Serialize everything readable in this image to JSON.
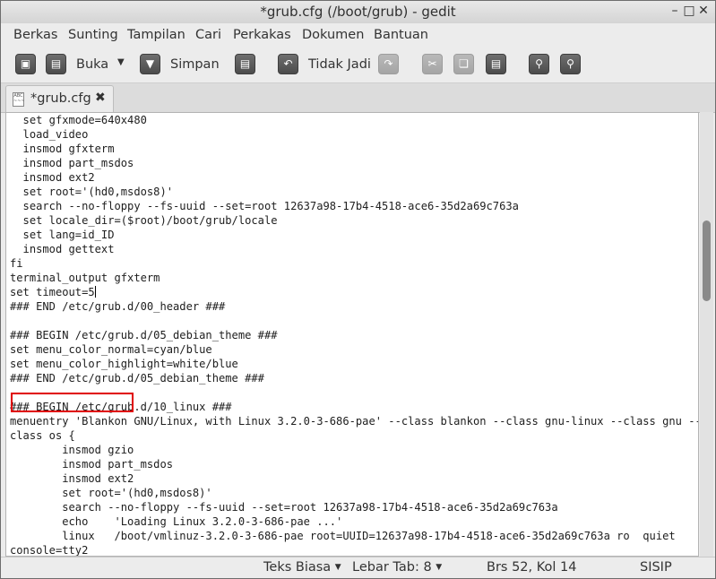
{
  "window": {
    "title": "*grub.cfg (/boot/grub) - gedit",
    "controls": [
      "–",
      "□",
      "✕"
    ]
  },
  "menubar": {
    "items": [
      "Berkas",
      "Sunting",
      "Tampilan",
      "Cari",
      "Perkakas",
      "Dokumen",
      "Bantuan"
    ]
  },
  "toolbar": {
    "open_label": "Buka",
    "save_label": "Simpan",
    "undo_label": "Tidak Jadi"
  },
  "tabs": [
    {
      "label": "*grub.cfg",
      "close": "✖"
    }
  ],
  "editor": {
    "lines": [
      "  set gfxmode=640x480",
      "  load_video",
      "  insmod gfxterm",
      "  insmod part_msdos",
      "  insmod ext2",
      "  set root='(hd0,msdos8)'",
      "  search --no-floppy --fs-uuid --set=root 12637a98-17b4-4518-ace6-35d2a69c763a",
      "  set locale_dir=($root)/boot/grub/locale",
      "  set lang=id_ID",
      "  insmod gettext",
      "fi",
      "terminal_output gfxterm",
      "set timeout=5",
      "### END /etc/grub.d/00_header ###",
      "",
      "### BEGIN /etc/grub.d/05_debian_theme ###",
      "set menu_color_normal=cyan/blue",
      "set menu_color_highlight=white/blue",
      "### END /etc/grub.d/05_debian_theme ###",
      "",
      "### BEGIN /etc/grub.d/10_linux ###",
      "menuentry 'Blankon GNU/Linux, with Linux 3.2.0-3-686-pae' --class blankon --class gnu-linux --class gnu --",
      "class os {",
      "        insmod gzio",
      "        insmod part_msdos",
      "        insmod ext2",
      "        set root='(hd0,msdos8)'",
      "        search --no-floppy --fs-uuid --set=root 12637a98-17b4-4518-ace6-35d2a69c763a",
      "        echo    'Loading Linux 3.2.0-3-686-pae ...'",
      "        linux   /boot/vmlinuz-3.2.0-3-686-pae root=UUID=12637a98-17b4-4518-ace6-35d2a69c763a ro  quiet",
      "console=tty2"
    ],
    "highlight_color": "#e00000"
  },
  "statusbar": {
    "syntax_label": "Teks Biasa",
    "tab_width_label": "Lebar Tab:",
    "tab_width_value": "8",
    "position": "Brs 52, Kol 14",
    "mode": "SISIP"
  }
}
